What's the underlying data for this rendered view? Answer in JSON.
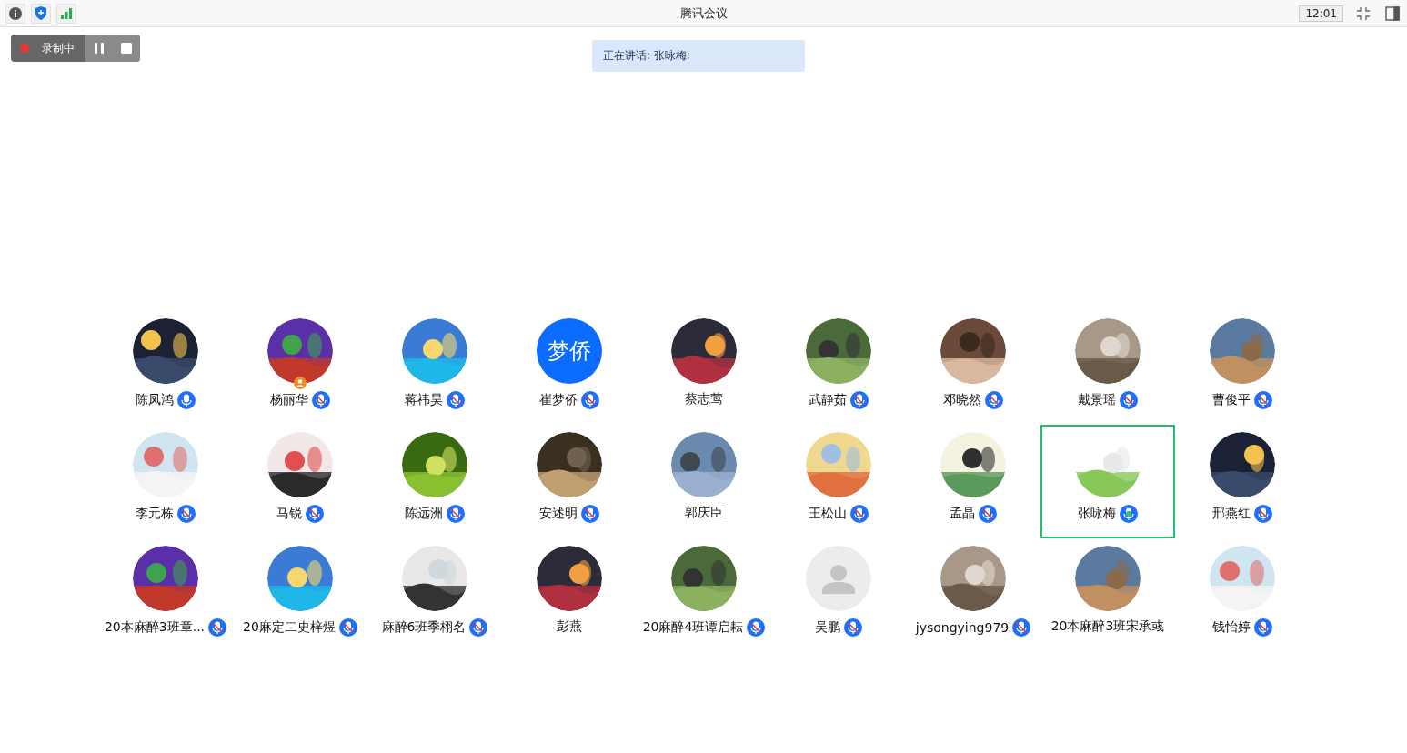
{
  "window": {
    "title": "腾讯会议",
    "time": "12:01"
  },
  "recording": {
    "label": "录制中"
  },
  "speaking_banner": "正在讲话: 张咏梅;",
  "participants": [
    {
      "name": "陈凤鸿",
      "mic": {
        "muted": false,
        "speaking": false
      },
      "host": false,
      "selected": false
    },
    {
      "name": "杨丽华",
      "mic": {
        "muted": true,
        "speaking": false
      },
      "host": true,
      "selected": false
    },
    {
      "name": "蒋祎昊",
      "mic": {
        "muted": true,
        "speaking": false
      },
      "host": false,
      "selected": false
    },
    {
      "name": "崔梦侨",
      "kind": "initials",
      "initials": "梦侨",
      "mic": {
        "muted": true,
        "speaking": false
      },
      "host": false,
      "selected": false
    },
    {
      "name": "蔡志莺",
      "host": false,
      "selected": false
    },
    {
      "name": "武静茹",
      "mic": {
        "muted": true,
        "speaking": false
      },
      "host": false,
      "selected": false
    },
    {
      "name": "邓晓然",
      "mic": {
        "muted": true,
        "speaking": false
      },
      "host": false,
      "selected": false
    },
    {
      "name": "戴景瑶",
      "mic": {
        "muted": true,
        "speaking": false
      },
      "host": false,
      "selected": false
    },
    {
      "name": "曹俊平",
      "mic": {
        "muted": true,
        "speaking": false
      },
      "host": false,
      "selected": false
    },
    {
      "name": "李元栋",
      "mic": {
        "muted": true,
        "speaking": false
      },
      "host": false,
      "selected": false
    },
    {
      "name": "马锐",
      "mic": {
        "muted": true,
        "speaking": false
      },
      "host": false,
      "selected": false
    },
    {
      "name": "陈远洲",
      "mic": {
        "muted": true,
        "speaking": false
      },
      "host": false,
      "selected": false
    },
    {
      "name": "安述明",
      "mic": {
        "muted": true,
        "speaking": false
      },
      "host": false,
      "selected": false
    },
    {
      "name": "郭庆臣",
      "host": false,
      "selected": false
    },
    {
      "name": "王松山",
      "mic": {
        "muted": true,
        "speaking": false
      },
      "host": false,
      "selected": false
    },
    {
      "name": "孟晶",
      "mic": {
        "muted": true,
        "speaking": false
      },
      "host": false,
      "selected": false
    },
    {
      "name": "张咏梅",
      "mic": {
        "muted": false,
        "speaking": true
      },
      "host": false,
      "selected": true
    },
    {
      "name": "邢燕红",
      "mic": {
        "muted": true,
        "speaking": false
      },
      "host": false,
      "selected": false
    },
    {
      "name": "20本麻醉3班章...",
      "mic": {
        "muted": true,
        "speaking": false
      },
      "host": false,
      "selected": false
    },
    {
      "name": "20麻定二史梓煜",
      "mic": {
        "muted": true,
        "speaking": false
      },
      "host": false,
      "selected": false
    },
    {
      "name": "麻醉6班季栩名",
      "mic": {
        "muted": true,
        "speaking": false
      },
      "host": false,
      "selected": false
    },
    {
      "name": "彭燕",
      "host": false,
      "selected": false
    },
    {
      "name": "20麻醉4班谭启耘",
      "mic": {
        "muted": true,
        "speaking": false
      },
      "host": false,
      "selected": false
    },
    {
      "name": "吴鹏",
      "kind": "default",
      "mic": {
        "muted": true,
        "speaking": false
      },
      "host": false,
      "selected": false
    },
    {
      "name": "jysongying979",
      "mic": {
        "muted": true,
        "speaking": false
      },
      "host": false,
      "selected": false
    },
    {
      "name": "20本麻醉3班宋承彧",
      "host": false,
      "selected": false
    },
    {
      "name": "钱怡婷",
      "mic": {
        "muted": true,
        "speaking": false
      },
      "host": false,
      "selected": false
    }
  ]
}
